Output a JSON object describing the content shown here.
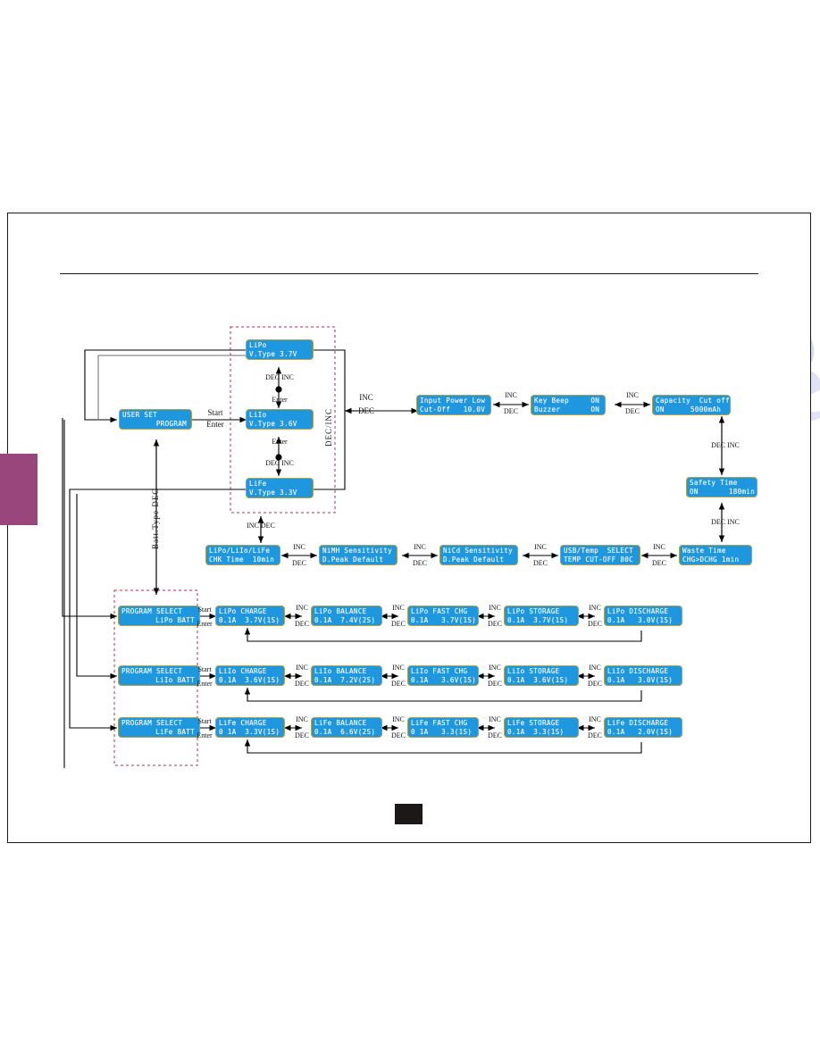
{
  "page": {
    "side_tab_color": "#98467c",
    "lcd_bg_color": "#1f97de",
    "lcd_border_color": "#b0a14a",
    "watermark_line_1": "ive.co",
    "watermark_line_2": "manualsarchive"
  },
  "labels": {
    "inc": "INC",
    "dec": "DEC",
    "start": "Start",
    "enter": "Enter",
    "dec_inc": "DEC INC",
    "inc_dec": "INC DEC",
    "dec_slash_inc": "DEC/INC",
    "batt_type_dec": "Batt.Type  DEC"
  },
  "screens": {
    "user_set_program": {
      "l1": "USER SET",
      "l2": "  PROGRAM"
    },
    "batt_type": [
      {
        "name": "lipo-vtype",
        "l1": "LiPo",
        "l2": "V.Type 3.7V"
      },
      {
        "name": "liio-vtype",
        "l1": "LiIo",
        "l2": "V.Type 3.6V"
      },
      {
        "name": "life-vtype",
        "l1": "LiFe",
        "l2": "V.Type 3.3V"
      }
    ],
    "settings_row_top": [
      {
        "name": "input-power-low",
        "l1": "Input Power Low",
        "l2": "Cut-Off   10.0V"
      },
      {
        "name": "key-beep",
        "l1": "Key Beep     ON",
        "l2": "Buzzer       ON"
      },
      {
        "name": "capacity-cutoff",
        "l1": "Capacity  Cut off",
        "l2": "ON      5000mAh"
      }
    ],
    "settings_right_column": [
      {
        "name": "safety-time",
        "l1": "Safety Time",
        "l2": "ON       180min"
      },
      {
        "name": "waste-time",
        "l1": "Waste Time",
        "l2": "CHG>DCHG 1min"
      }
    ],
    "settings_row_bottom": [
      {
        "name": "chk-time",
        "l1": "LiPo/LiIo/LiFe",
        "l2": "CHK Time  10min"
      },
      {
        "name": "nimh-sensitivity",
        "l1": "NiMH Sensitivity",
        "l2": "D.Peak Default"
      },
      {
        "name": "nicd-sensitivity",
        "l1": "NiCd Sensitivity",
        "l2": "D.Peak Default"
      },
      {
        "name": "usb-temp-select",
        "l1": "USB/Temp  SELECT",
        "l2": "TEMP CUT-OFF 80C"
      }
    ],
    "program_rows": [
      {
        "name": "lipo-row",
        "select": {
          "l1": "PROGRAM SELECT",
          "l2": "LiPo BATT"
        },
        "items": [
          {
            "name": "lipo-charge",
            "l1": "LiPo CHARGE",
            "l2": "0.1A  3.7V(1S)"
          },
          {
            "name": "lipo-balance",
            "l1": "LiPo BALANCE",
            "l2": "0.1A  7.4V(2S)"
          },
          {
            "name": "lipo-fast-chg",
            "l1": "LiPo FAST CHG",
            "l2": "0.1A   3.7V(1S)"
          },
          {
            "name": "lipo-storage",
            "l1": "LiPo STORAGE",
            "l2": "0.1A  3.7V(1S)"
          },
          {
            "name": "lipo-discharge",
            "l1": "LiPo DISCHARGE",
            "l2": "0.1A   3.0V(1S)"
          }
        ]
      },
      {
        "name": "liio-row",
        "select": {
          "l1": "PROGRAM SELECT",
          "l2": "LiIo BATT"
        },
        "items": [
          {
            "name": "liio-charge",
            "l1": "LiIo CHARGE",
            "l2": "0.1A  3.6V(1S)"
          },
          {
            "name": "liio-balance",
            "l1": "LiIo BALANCE",
            "l2": "0.1A  7.2V(2S)"
          },
          {
            "name": "liio-fast-chg",
            "l1": "LiIo FAST CHG",
            "l2": "0.1A   3.6V(1S)"
          },
          {
            "name": "liio-storage",
            "l1": "LiIo STORAGE",
            "l2": "0.1A  3.6V(1S)"
          },
          {
            "name": "liio-discharge",
            "l1": "LiIo DISCHARGE",
            "l2": "0.1A   3.0V(1S)"
          }
        ]
      },
      {
        "name": "life-row",
        "select": {
          "l1": "PROGRAM SELECT",
          "l2": "LiFe BATT"
        },
        "items": [
          {
            "name": "life-charge",
            "l1": "LiFe CHARGE",
            "l2": "0 1A  3.3V(1S)"
          },
          {
            "name": "life-balance",
            "l1": "LiFe BALANCE",
            "l2": "0.1A  6.6V(2S)"
          },
          {
            "name": "life-fast-chg",
            "l1": "LiFe FAST CHG",
            "l2": "0 1A   3.3(1S)"
          },
          {
            "name": "life-storage",
            "l1": "LiFe STORAGE",
            "l2": "0.1A  3.3(1S)"
          },
          {
            "name": "life-discharge",
            "l1": "LiFe DISCHARGE",
            "l2": "0.1A   2.0V(1S)"
          }
        ]
      }
    ]
  }
}
